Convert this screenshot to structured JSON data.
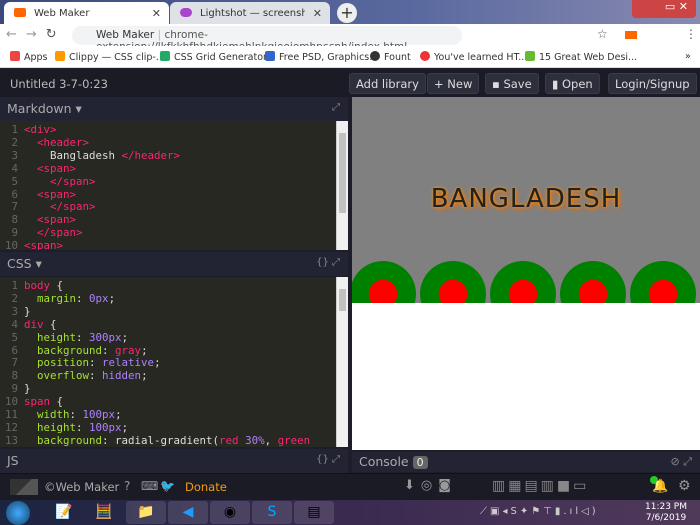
{
  "browser": {
    "tabs": [
      {
        "label": "Web Maker"
      },
      {
        "label": "Lightshot — screenshot tool for M"
      }
    ],
    "address": {
      "site": "Web Maker",
      "url": "chrome-extension://lkfkkhfhhdkiemehlpkgjeojomhpccnh/index.html"
    },
    "bookmarks": [
      {
        "label": "Apps",
        "color": "#e44"
      },
      {
        "label": "Clippy — CSS clip-...",
        "color": "#f90"
      },
      {
        "label": "CSS Grid Generator...",
        "color": "#2a6"
      },
      {
        "label": "Free PSD, Graphics...",
        "color": "#36c"
      },
      {
        "label": "Fount",
        "color": "#333"
      },
      {
        "label": "You've learned HT...",
        "color": "#e33"
      },
      {
        "label": "15 Great Web Desi...",
        "color": "#6b3"
      }
    ]
  },
  "app": {
    "title": "Untitled 3-7-0:23",
    "buttons": {
      "add_library": "Add library",
      "new": "+ New",
      "save": "Save",
      "open": "Open",
      "login": "Login/Signup"
    },
    "panels": {
      "markdown": "Markdown ▾",
      "css": "CSS ▾",
      "js": "JS",
      "braces": "{}",
      "expand": "⤢"
    },
    "html_lines": [
      [
        "1",
        "<div>"
      ],
      [
        "2",
        "  <header>"
      ],
      [
        "3",
        "    Bangladesh </header>"
      ],
      [
        "4",
        "  <span>"
      ],
      [
        "5",
        "    </span>"
      ],
      [
        "6",
        "  <span>"
      ],
      [
        "7",
        "    </span>"
      ],
      [
        "8",
        "  <span>"
      ],
      [
        "9",
        "  </span>"
      ],
      [
        "10",
        "<span>"
      ]
    ],
    "css_lines": [
      [
        "1",
        "body {"
      ],
      [
        "2",
        "  margin: 0px;"
      ],
      [
        "3",
        "}"
      ],
      [
        "4",
        "div {"
      ],
      [
        "5",
        "  height: 300px;"
      ],
      [
        "6",
        "  background: gray;"
      ],
      [
        "7",
        "  position: relative;"
      ],
      [
        "8",
        "  overflow: hidden;"
      ],
      [
        "9",
        "}"
      ],
      [
        "10",
        "span {"
      ],
      [
        "11",
        "  width: 100px;"
      ],
      [
        "12",
        "  height: 100px;"
      ],
      [
        "13",
        "  background: radial-gradient(red 30%, green"
      ]
    ],
    "preview_heading": "BANGLADESH",
    "console": {
      "label": "Console",
      "count": "0"
    },
    "footer": {
      "brand": "©Web Maker",
      "donate": "Donate"
    }
  },
  "taskbar": {
    "time": "11:23 PM",
    "date": "7/6/2019"
  },
  "colors": {
    "accent": "#f39c12",
    "flag_red": "red",
    "flag_green": "green"
  }
}
